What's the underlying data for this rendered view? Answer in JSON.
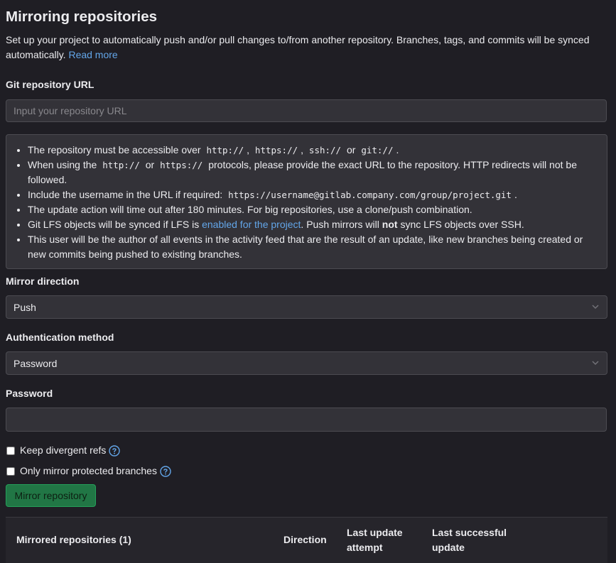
{
  "page": {
    "title": "Mirroring repositories",
    "description": "Set up your project to automatically push and/or pull changes to/from another repository. Branches, tags, and commits will be synced automatically.",
    "read_more": "Read more"
  },
  "url_field": {
    "label": "Git repository URL",
    "placeholder": "Input your repository URL",
    "value": ""
  },
  "info": {
    "item1_a": "The repository must be accessible over",
    "item1_code1": "http://",
    "item1_sep1": ",",
    "item1_code2": "https://",
    "item1_sep2": ",",
    "item1_code3": "ssh://",
    "item1_or": "or",
    "item1_code4": "git://",
    "item1_end": ".",
    "item2_a": "When using the",
    "item2_code1": "http://",
    "item2_or": "or",
    "item2_code2": "https://",
    "item2_b": "protocols, please provide the exact URL to the repository. HTTP redirects will not be followed.",
    "item3_a": "Include the username in the URL if required:",
    "item3_code": "https://username@gitlab.company.com/group/project.git",
    "item3_end": ".",
    "item4": "The update action will time out after 180 minutes. For big repositories, use a clone/push combination.",
    "item5_a": "Git LFS objects will be synced if LFS is",
    "item5_link": "enabled for the project",
    "item5_b": ". Push mirrors will",
    "item5_bold": "not",
    "item5_c": "sync LFS objects over SSH.",
    "item6": "This user will be the author of all events in the activity feed that are the result of an update, like new branches being created or new commits being pushed to existing branches."
  },
  "direction": {
    "label": "Mirror direction",
    "selected": "Push"
  },
  "auth": {
    "label": "Authentication method",
    "selected": "Password"
  },
  "password": {
    "label": "Password",
    "value": ""
  },
  "options": {
    "keep_divergent": "Keep divergent refs",
    "only_protected": "Only mirror protected branches"
  },
  "button": {
    "label": "Mirror repository"
  },
  "table": {
    "col_repos": "Mirrored repositories (1)",
    "col_direction": "Direction",
    "col_last_attempt_1": "Last update",
    "col_last_attempt_2": "attempt",
    "col_last_success_1": "Last successful",
    "col_last_success_2": "update"
  },
  "colors": {
    "background": "#1f1e24",
    "link": "#63a6e9",
    "button_bg": "#217645",
    "button_border": "#24a05a",
    "input_bg": "#333238"
  }
}
